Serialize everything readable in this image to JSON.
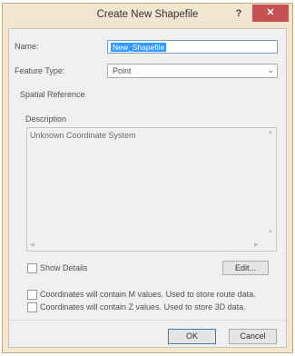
{
  "window": {
    "title": "Create New Shapefile",
    "help_label": "?",
    "close_label": "✕"
  },
  "form": {
    "name_label": "Name:",
    "name_value": "New_Shapefile",
    "feature_type_label": "Feature Type:",
    "feature_type_value": "Point",
    "spatial_reference_label": "Spatial Reference",
    "description_label": "Description",
    "description_text": "Unknown Coordinate System",
    "show_details_label": "Show Details",
    "edit_button_label": "Edit...",
    "m_values_label": "Coordinates will contain M values. Used to store route data.",
    "z_values_label": "Coordinates will contain Z values. Used to store 3D data."
  },
  "buttons": {
    "ok_label": "OK",
    "cancel_label": "Cancel"
  },
  "colors": {
    "frame": "#f2e6d2",
    "close_button": "#c75050",
    "selection": "#3399ff"
  }
}
